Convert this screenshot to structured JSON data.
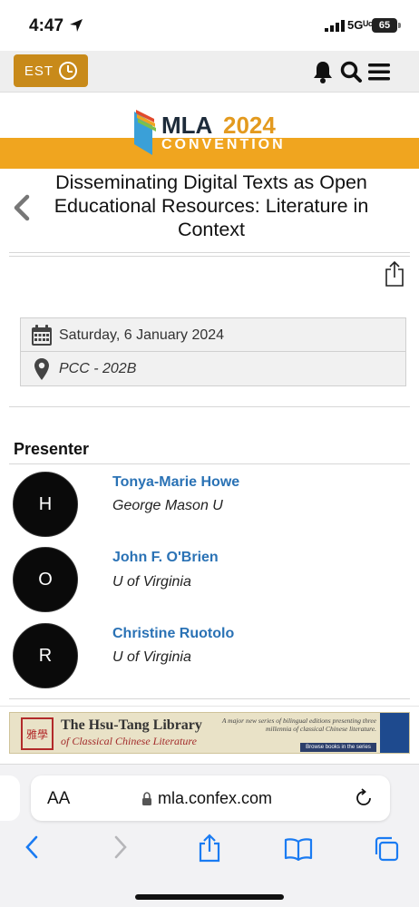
{
  "status_bar": {
    "time": "4:47",
    "network": "5Gᵁᶜ",
    "battery": "65"
  },
  "header": {
    "timezone_label": "EST"
  },
  "logo": {
    "mla": "MLA",
    "year": "2024",
    "subtitle": "CONVENTION"
  },
  "session": {
    "title": "Disseminating Digital Texts as Open Educational Resources: Literature in Context",
    "date": "Saturday, 6 January 2024",
    "location": "PCC - 202B"
  },
  "presenters": {
    "heading": "Presenter",
    "items": [
      {
        "initial": "H",
        "name": "Tonya-Marie Howe",
        "affiliation": "George Mason U"
      },
      {
        "initial": "O",
        "name": "John F. O'Brien",
        "affiliation": "U of Virginia"
      },
      {
        "initial": "R",
        "name": "Christine Ruotolo",
        "affiliation": "U of Virginia"
      }
    ]
  },
  "ad": {
    "seal_text": "雅學",
    "title": "The Hsu-Tang Library",
    "subtitle": "of Classical Chinese Literature",
    "tagline": "A major new series of bilingual editions presenting three millennia of classical Chinese literature.",
    "button": "Browse books in the series"
  },
  "browser": {
    "text_size_label": "AA",
    "url": "mla.confex.com"
  },
  "colors": {
    "accent_gold": "#f0a51f",
    "tz_button": "#c88a1a",
    "link_blue": "#2a72b5",
    "navy": "#1d2b3a"
  }
}
